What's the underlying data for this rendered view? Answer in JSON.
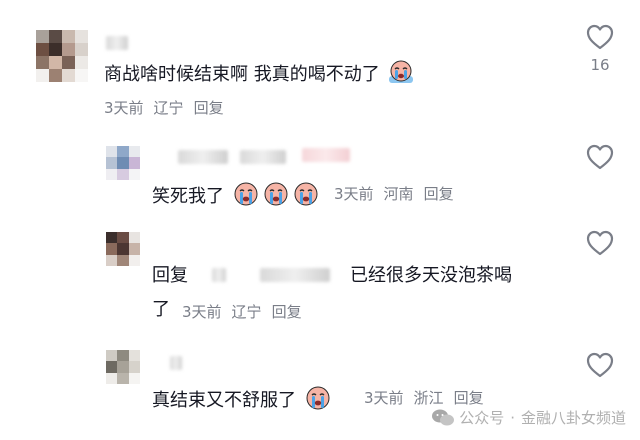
{
  "comments": [
    {
      "text": "商战啥时候结束啊 我真的喝不动了",
      "date": "3天前",
      "location": "辽宁",
      "reply_label": "回复",
      "like_count": "16"
    },
    {
      "text": "笑死我了",
      "date": "3天前",
      "location": "河南",
      "reply_label": "回复"
    },
    {
      "text_prefix": "回复",
      "text_line1_end": "已经很多天没泡茶喝",
      "text_line2": "了",
      "date": "3天前",
      "location": "辽宁",
      "reply_label": "回复"
    },
    {
      "text": "真结束又不舒服了",
      "date": "3天前",
      "location": "浙江",
      "reply_label": "回复"
    }
  ],
  "watermark": {
    "platform": "公众号",
    "separator": "·",
    "account": "金融八卦女频道"
  },
  "icons": {
    "like": "heart-outline-icon",
    "emoji": "crying-emoji-icon",
    "watermark": "wechat-logo-icon"
  },
  "colors": {
    "text": "#161823",
    "meta": "#7a7e88",
    "emoji_face": "#f6b4a6",
    "emoji_tears": "#4aa3e8"
  }
}
